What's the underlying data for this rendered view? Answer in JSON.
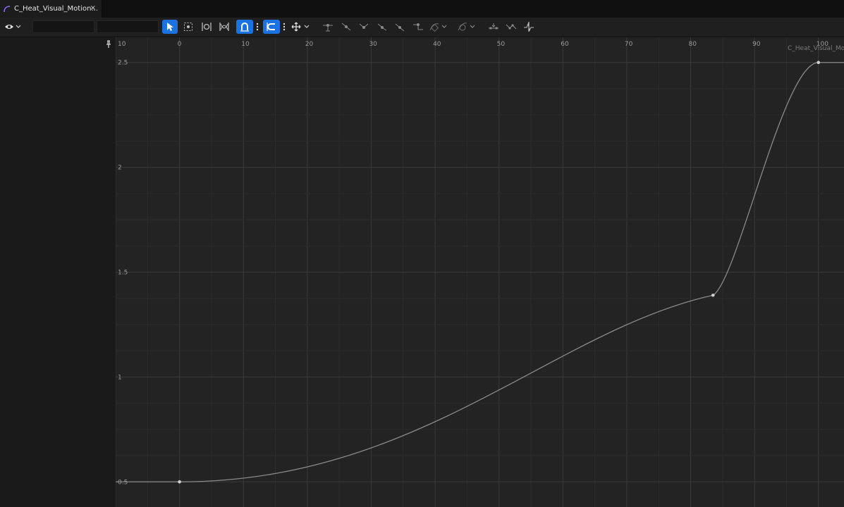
{
  "tab": {
    "title": "C_Heat_Visual_Motion...",
    "close_label": "×"
  },
  "graph": {
    "curve_label": "C_Heat_Visual_Mo",
    "x_ticks": [
      "10",
      "0",
      "10",
      "20",
      "30",
      "40",
      "50",
      "60",
      "70",
      "80",
      "90",
      "100"
    ],
    "x_tick_values": [
      -10,
      0,
      10,
      20,
      30,
      40,
      50,
      60,
      70,
      80,
      90,
      100
    ],
    "y_ticks": [
      "2.5",
      "2",
      "1.5",
      "1",
      "0.5"
    ],
    "y_tick_values": [
      2.5,
      2,
      1.5,
      1,
      0.5
    ]
  },
  "chart_data": {
    "type": "line",
    "x": [
      0,
      83.5,
      100
    ],
    "y": [
      0.5,
      1.39,
      2.5
    ],
    "xlim": [
      -10,
      104
    ],
    "ylim": [
      0.38,
      2.62
    ],
    "grid": true,
    "line_color": "#8a8a8a",
    "key_color": "#d0d0d0"
  },
  "colors": {
    "accent": "#1a73e0",
    "grid_major": "#3a3a3a",
    "grid_minor": "#2c2c2c"
  }
}
